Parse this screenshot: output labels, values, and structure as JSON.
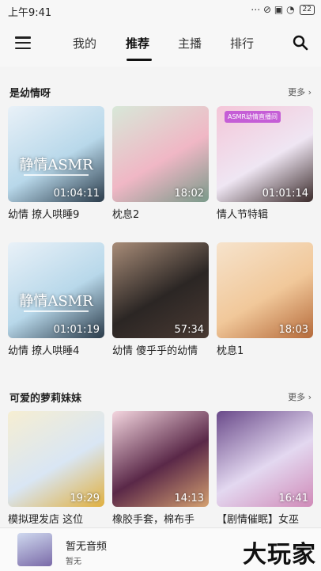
{
  "status_bar": {
    "time": "上午9:41",
    "icons": "⋯ ⊘ ▣ ◔",
    "battery": "22"
  },
  "nav": {
    "tabs": [
      "我的",
      "推荐",
      "主播",
      "排行"
    ],
    "active_tab": "推荐"
  },
  "sections": [
    {
      "title": "是幼情呀",
      "more": "更多",
      "items": [
        {
          "label": "幼情 撩人哄睡9",
          "duration": "01:04:11",
          "watermark": "静情ASMR",
          "banner": "",
          "colors": [
            "#b8d8ea",
            "#e9f1f8",
            "#2a3b4a"
          ]
        },
        {
          "label": "枕息2",
          "duration": "18:02",
          "watermark": "",
          "banner": "",
          "colors": [
            "#f0b7c5",
            "#d7e8d8",
            "#7a9a8a"
          ]
        },
        {
          "label": "情人节特辑",
          "duration": "01:01:14",
          "watermark": "",
          "banner": "ASMR幼情直播间",
          "colors": [
            "#efe6f3",
            "#f4c6d8",
            "#3a2a2a"
          ]
        },
        {
          "label": "幼情 撩人哄睡4",
          "duration": "01:01:19",
          "watermark": "静情ASMR",
          "banner": "",
          "colors": [
            "#b8d8ea",
            "#e9f1f8",
            "#2a3b4a"
          ]
        },
        {
          "label": "幼情 傻乎乎的幼情",
          "duration": "57:34",
          "watermark": "",
          "banner": "",
          "colors": [
            "#2b2624",
            "#a88c78",
            "#4a3a33"
          ]
        },
        {
          "label": "枕息1",
          "duration": "18:03",
          "watermark": "",
          "banner": "",
          "colors": [
            "#f1c89a",
            "#f6e3cc",
            "#b56a3a"
          ]
        }
      ]
    },
    {
      "title": "可爱的萝莉妹妹",
      "more": "更多",
      "items": [
        {
          "label": "模拟理发店 这位",
          "duration": "19:29",
          "watermark": "",
          "banner": "",
          "colors": [
            "#d9e6f4",
            "#f6eed2",
            "#e0b040"
          ]
        },
        {
          "label": "橡胶手套，棉布手",
          "duration": "14:13",
          "watermark": "",
          "banner": "",
          "colors": [
            "#5a2848",
            "#f4d6df",
            "#d4a070"
          ]
        },
        {
          "label": "【剧情催眠】女巫",
          "duration": "16:41",
          "watermark": "",
          "banner": "",
          "colors": [
            "#e3d8f0",
            "#6a4a8a",
            "#d08ab8"
          ]
        }
      ]
    }
  ],
  "player": {
    "title": "暂无音频",
    "subtitle": "暂无",
    "logo": "大玩家",
    "colors": [
      "#cfd9ef",
      "#7a6aa8"
    ]
  },
  "accent": "#111111"
}
